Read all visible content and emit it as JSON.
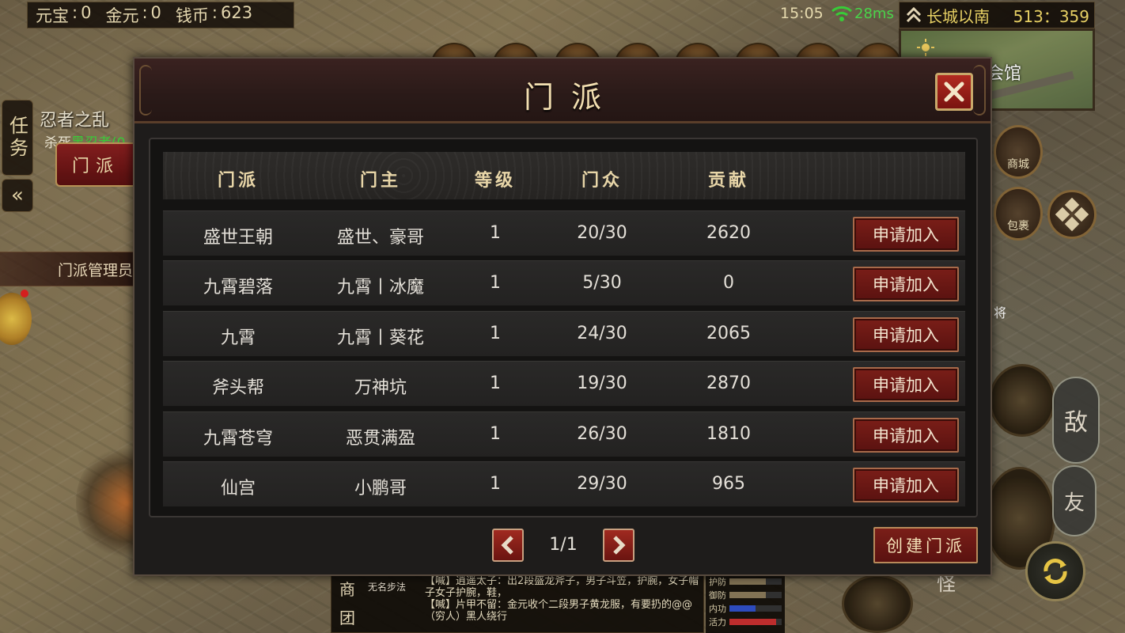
{
  "hud": {
    "currency": [
      {
        "label": "元宝",
        "value": "0"
      },
      {
        "label": "金元",
        "value": "0"
      },
      {
        "label": "钱币",
        "value": "623"
      }
    ],
    "time": "15:05",
    "ping": "28ms",
    "location": "长城以南",
    "coords": "513：359",
    "minimap_label": "会馆"
  },
  "left_panel": {
    "quest_tab": "任务",
    "collapse_icon": "«",
    "quest_title": "忍者之乱",
    "quest_desc_prefix": "杀死",
    "quest_desc_highlight": "黑忍者(0",
    "sect_button": "门派",
    "npc_label": "门派管理员"
  },
  "right_panel": {
    "shop_label": "商城",
    "bag_label": "包裹",
    "jiang_text": "将",
    "enemy_label": "敌",
    "friend_label": "友",
    "monster_label": "怪"
  },
  "modal": {
    "title": "门派",
    "close_icon": "close-icon",
    "columns": [
      "门派",
      "门主",
      "等级",
      "门众",
      "贡献"
    ],
    "rows": [
      {
        "name": "盛世王朝",
        "leader": "盛世、豪哥",
        "level": "1",
        "members": "20/30",
        "contribution": "2620",
        "action": "申请加入"
      },
      {
        "name": "九霄碧落",
        "leader": "九霄丨冰魔",
        "level": "1",
        "members": "5/30",
        "contribution": "0",
        "action": "申请加入"
      },
      {
        "name": "九霄",
        "leader": "九霄丨葵花",
        "level": "1",
        "members": "24/30",
        "contribution": "2065",
        "action": "申请加入"
      },
      {
        "name": "斧头帮",
        "leader": "万神坑",
        "level": "1",
        "members": "19/30",
        "contribution": "2870",
        "action": "申请加入"
      },
      {
        "name": "九霄苍穹",
        "leader": "恶贯满盈",
        "level": "1",
        "members": "26/30",
        "contribution": "1810",
        "action": "申请加入"
      },
      {
        "name": "仙宫",
        "leader": "小鹏哥",
        "level": "1",
        "members": "29/30",
        "contribution": "965",
        "action": "申请加入"
      }
    ],
    "page": "1/1",
    "create_button": "创建门派"
  },
  "chat": {
    "tab1": "商",
    "tab2": "团",
    "name": "无名步法",
    "lines": [
      "【喊】逍遥太子：出2段盛龙斧子，男子斗笠，护腕，女子帽子女子护腕，鞋，",
      "【喊】片甲不留：金元收个二段男子黄龙服，有要扔的@@（穷人）黑人绕行"
    ]
  },
  "stats": [
    {
      "label": "护防",
      "color": "#8a7a5a",
      "level": 0.7
    },
    {
      "label": "御防",
      "color": "#8a7a5a",
      "level": 0.7
    },
    {
      "label": "内功",
      "color": "#3050c8",
      "level": 0.5
    },
    {
      "label": "活力",
      "color": "#c83030",
      "level": 0.9
    }
  ]
}
